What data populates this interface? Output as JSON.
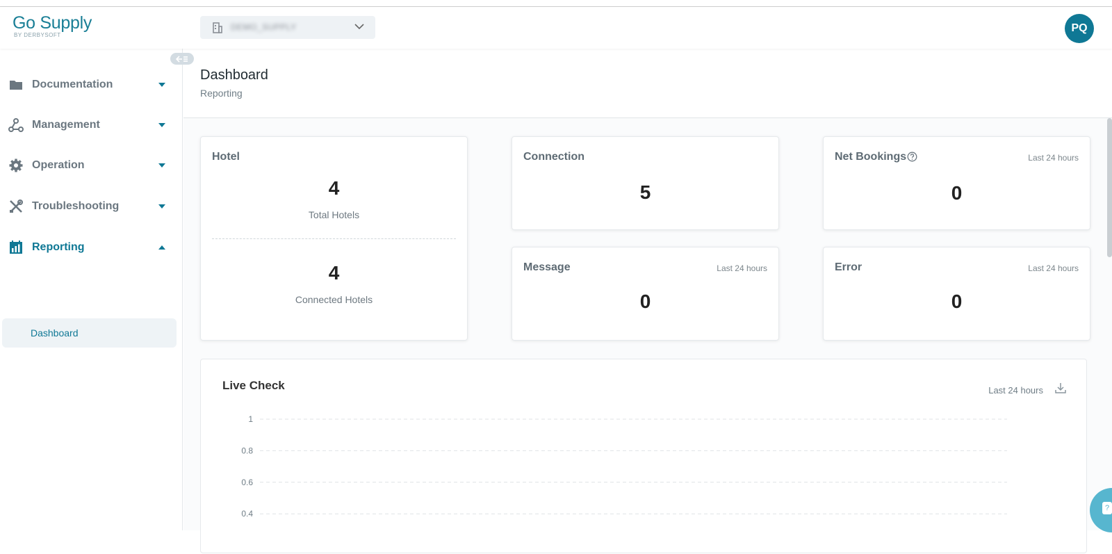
{
  "header": {
    "logo_main": "Go Supply",
    "logo_sub": "BY DERBYSOFT",
    "org_selector": {
      "value": "DEMO_SUPPLY"
    },
    "avatar_initials": "PQ"
  },
  "sidebar": {
    "items": [
      {
        "label": "Documentation",
        "icon": "folder-icon",
        "expanded": false
      },
      {
        "label": "Management",
        "icon": "network-icon",
        "expanded": false
      },
      {
        "label": "Operation",
        "icon": "gear-icon",
        "expanded": false
      },
      {
        "label": "Troubleshooting",
        "icon": "tools-icon",
        "expanded": false
      },
      {
        "label": "Reporting",
        "icon": "bar-chart-calendar-icon",
        "expanded": true,
        "active": true
      }
    ],
    "subitems": [
      {
        "label": "Dashboard",
        "active": true
      }
    ]
  },
  "page": {
    "title": "Dashboard",
    "subtitle": "Reporting"
  },
  "cards": {
    "hotel": {
      "title": "Hotel",
      "total_value": "4",
      "total_label": "Total Hotels",
      "connected_value": "4",
      "connected_label": "Connected Hotels"
    },
    "connection": {
      "title": "Connection",
      "value": "5"
    },
    "net_bookings": {
      "title": "Net Bookings",
      "period": "Last 24 hours",
      "value": "0"
    },
    "message": {
      "title": "Message",
      "period": "Last 24 hours",
      "value": "0"
    },
    "error": {
      "title": "Error",
      "period": "Last 24 hours",
      "value": "0"
    }
  },
  "live_check": {
    "title": "Live Check",
    "period": "Last 24 hours"
  },
  "chart_data": {
    "type": "line",
    "title": "Live Check",
    "y_ticks": [
      "1",
      "0.8",
      "0.6",
      "0.4"
    ],
    "ylim": [
      0,
      1
    ],
    "grid": true,
    "series": []
  },
  "colors": {
    "brand": "#0f7895",
    "logo": "#1a7f96",
    "muted_text": "#6b7780"
  }
}
